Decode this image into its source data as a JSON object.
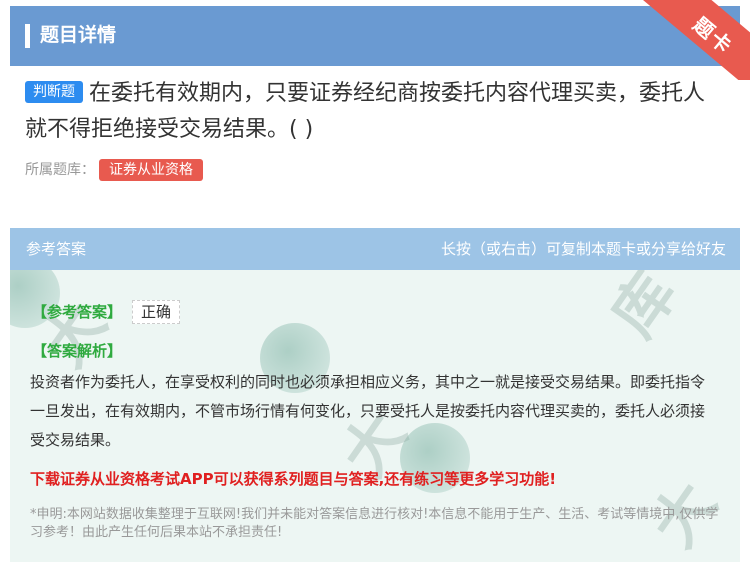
{
  "header": {
    "title": "题目详情",
    "corner_label": "题卡"
  },
  "question": {
    "type_tag": "判断题",
    "text": "在委托有效期内，只要证券经纪商按委托内容代理买卖，委托人就不得拒绝接受交易结果。( )",
    "source_label": "所属题库：",
    "source_tag": "证券从业资格"
  },
  "answer_panel": {
    "header_left": "参考答案",
    "header_right": "长按（或右击）可复制本题卡或分享给好友",
    "answer_label": "【参考答案】",
    "answer_value": "正确",
    "analysis_label": "【答案解析】",
    "analysis_text": "投资者作为委托人，在享受权利的同时也必须承担相应义务，其中之一就是接受交易结果。即委托指令一旦发出，在有效期内，不管市场行情有何变化，只要受托人是按委托内容代理买卖的，委托人必须接受交易结果。",
    "promo_text": "下载证券从业资格考试APP可以获得系列题目与答案,还有练习等更多学习功能!",
    "disclaimer": "*申明:本网站数据收集整理于互联网!我们并未能对答案信息进行核对!本信息不能用于生产、生活、考试等情境中,仅供学习参考！由此产生任何后果本站不承担责任!"
  },
  "colors": {
    "header_bg": "#6a9ad2",
    "answer_header_bg": "#9dc4e6",
    "panel_bg": "#edf6f3",
    "type_tag": "#2d8cf0",
    "source_tag": "#e85a4f",
    "corner": "#e85a4f",
    "green_label": "#2faa3f",
    "promo_red": "#e02020"
  }
}
